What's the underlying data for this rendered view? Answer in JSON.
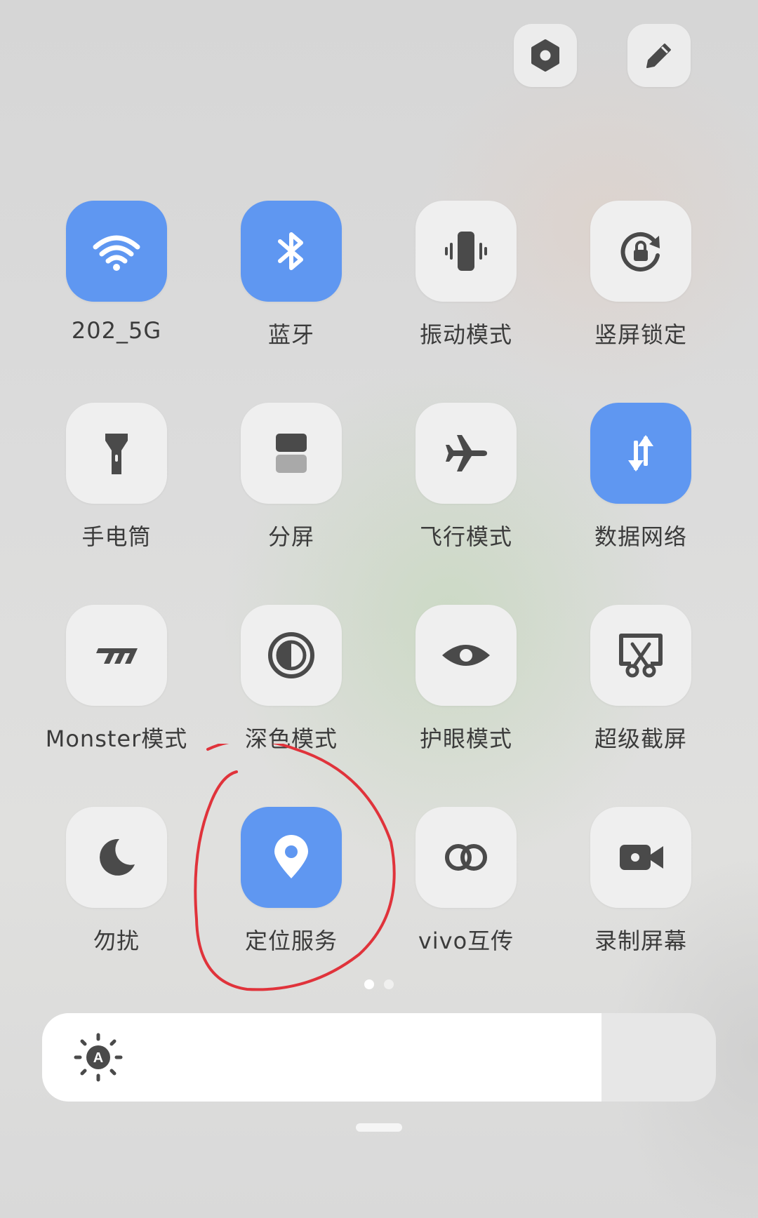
{
  "header": {
    "settings_icon": "hexagon-gear-icon",
    "edit_icon": "pencil-icon"
  },
  "tiles": [
    {
      "label": "202_5G",
      "icon": "wifi-icon",
      "active": true
    },
    {
      "label": "蓝牙",
      "icon": "bluetooth-icon",
      "active": true
    },
    {
      "label": "振动模式",
      "icon": "vibrate-icon",
      "active": false
    },
    {
      "label": "竖屏锁定",
      "icon": "rotation-lock-icon",
      "active": false
    },
    {
      "label": "手电筒",
      "icon": "flashlight-icon",
      "active": false
    },
    {
      "label": "分屏",
      "icon": "split-screen-icon",
      "active": false
    },
    {
      "label": "飞行模式",
      "icon": "airplane-icon",
      "active": false
    },
    {
      "label": "数据网络",
      "icon": "mobile-data-icon",
      "active": true
    },
    {
      "label": "Monster模式",
      "icon": "monster-mode-icon",
      "active": false
    },
    {
      "label": "深色模式",
      "icon": "dark-mode-icon",
      "active": false
    },
    {
      "label": "护眼模式",
      "icon": "eye-icon",
      "active": false
    },
    {
      "label": "超级截屏",
      "icon": "screenshot-scissors-icon",
      "active": false
    },
    {
      "label": "勿扰",
      "icon": "moon-icon",
      "active": false
    },
    {
      "label": "定位服务",
      "icon": "location-pin-icon",
      "active": true
    },
    {
      "label": "vivo互传",
      "icon": "link-rings-icon",
      "active": false
    },
    {
      "label": "录制屏幕",
      "icon": "video-camera-icon",
      "active": false
    }
  ],
  "pager": {
    "current": 1,
    "total": 2
  },
  "brightness": {
    "level_percent": 83,
    "icon": "auto-brightness-icon",
    "auto_letter": "A"
  },
  "colors": {
    "accent": "#5f97f1",
    "annotation": "#e0333b",
    "tile_inactive": "#efefef",
    "label_text": "#3b3b3b"
  }
}
